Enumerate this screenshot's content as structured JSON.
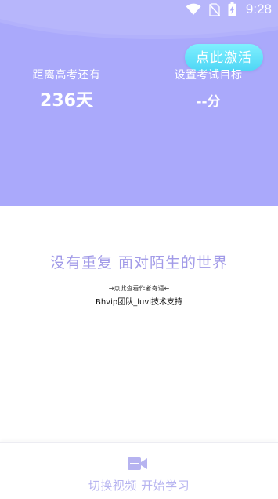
{
  "status_bar": {
    "time": "9:28",
    "icons": [
      "wifi-icon",
      "no-sim-icon",
      "battery-charging-icon"
    ]
  },
  "header": {
    "activate_button": "点此激活",
    "countdown": {
      "label": "距离高考还有",
      "value": "236天"
    },
    "target_score": {
      "label": "设置考试目标",
      "value": "--分"
    }
  },
  "main": {
    "slogan": "没有重复 面对陌生的世界",
    "author_link": "→点此查看作者寄语←",
    "credit": "Bhvip团队_luvl技术支持"
  },
  "bottom": {
    "switch_button_label": "切换视频 开始学习",
    "switch_button_icon": "video-camera-icon"
  },
  "colors": {
    "header_bg": "#aaa9fb",
    "activate_bg": "#5fe0f8",
    "slogan": "#a29be8",
    "bottom_label": "#b6b3f0"
  }
}
